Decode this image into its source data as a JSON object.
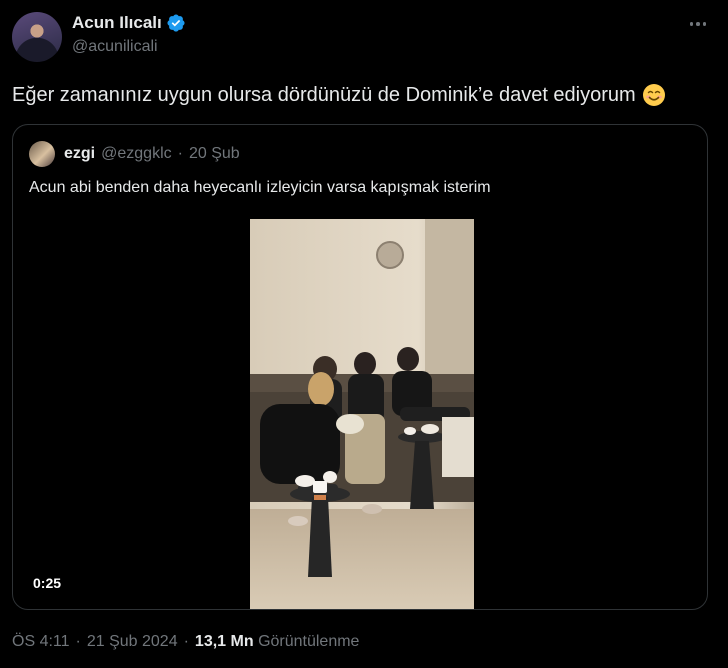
{
  "tweet": {
    "author_name": "Acun Ilıcalı",
    "author_handle": "@acunilicali",
    "text": "Eğer zamanınız uygun olursa dördünüzü de Dominik’e davet ediyorum",
    "emoji": "smiling-face-icon"
  },
  "quoted": {
    "author_name": "ezgi",
    "author_handle": "@ezggklc",
    "separator": "·",
    "date": "20 Şub",
    "text": "Acun abi benden daha heyecanlı izleyicin varsa kapışmak isterim",
    "video_duration": "0:25"
  },
  "footer": {
    "time": "ÖS 4:11",
    "separator1": "·",
    "date": "21 Şub 2024",
    "separator2": "·",
    "views_count": "13,1 Mn",
    "views_label": "Görüntülenme"
  },
  "colors": {
    "background": "#000000",
    "text_primary": "#e7e9ea",
    "text_secondary": "#71767b",
    "border": "#2f3336",
    "verified": "#1d9bf0"
  }
}
